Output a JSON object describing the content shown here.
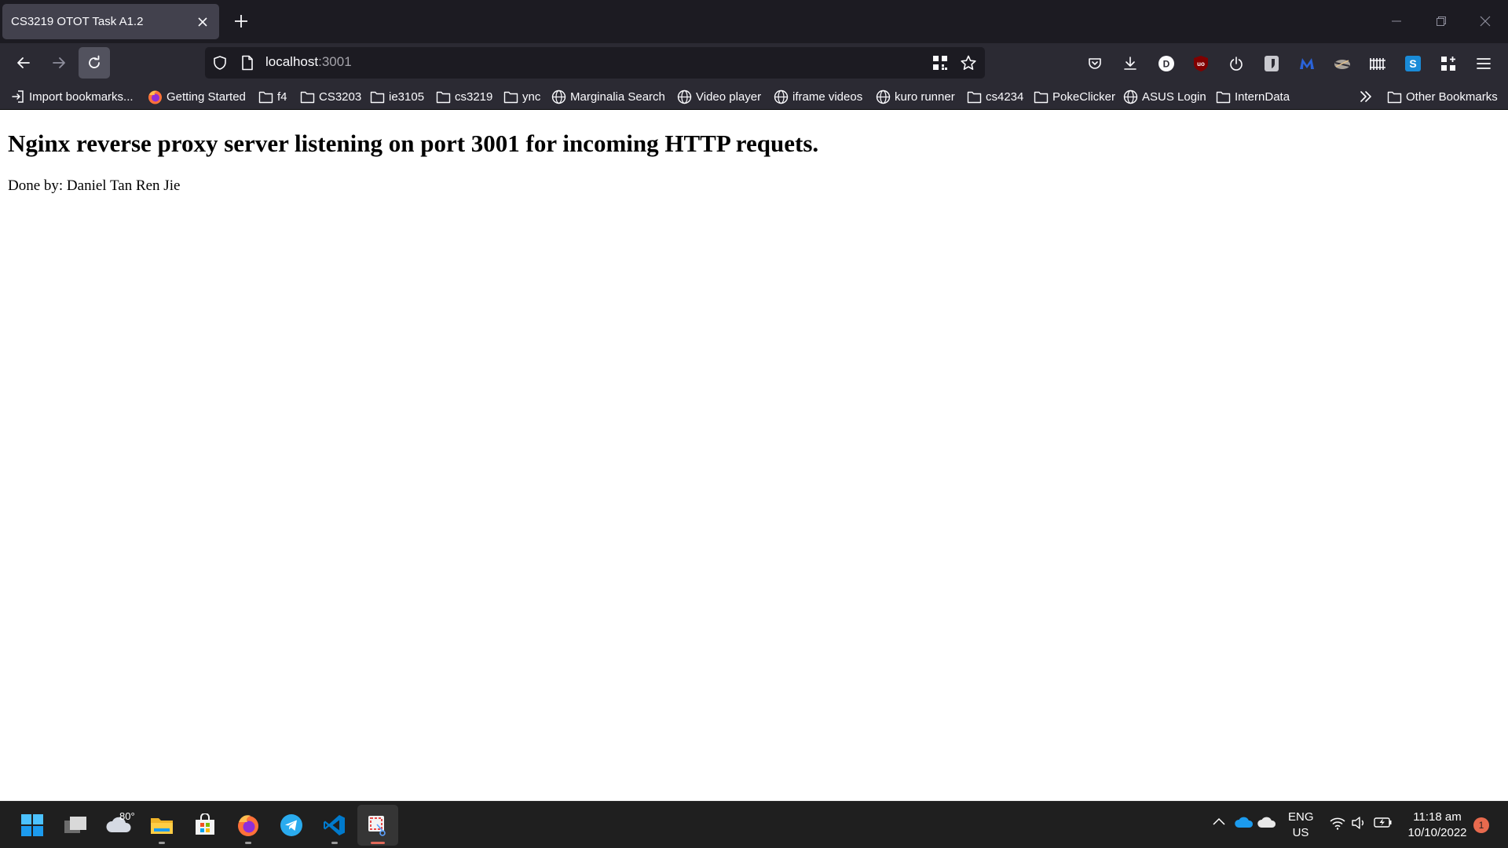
{
  "browser": {
    "tab": {
      "title": "CS3219 OTOT Task A1.2"
    },
    "url": {
      "host": "localhost",
      "port": ":3001"
    }
  },
  "bookmarks": [
    {
      "label": "Import bookmarks...",
      "icon": "import-icon"
    },
    {
      "label": "Getting Started",
      "icon": "firefox-icon"
    },
    {
      "label": "f4",
      "icon": "folder-icon"
    },
    {
      "label": "CS3203",
      "icon": "folder-icon"
    },
    {
      "label": "ie3105",
      "icon": "folder-icon"
    },
    {
      "label": "cs3219",
      "icon": "folder-icon"
    },
    {
      "label": "ync",
      "icon": "folder-icon"
    },
    {
      "label": "Marginalia Search",
      "icon": "globe-icon"
    },
    {
      "label": "Video player",
      "icon": "globe-icon"
    },
    {
      "label": "iframe videos",
      "icon": "globe-icon"
    },
    {
      "label": "kuro runner",
      "icon": "globe-icon"
    },
    {
      "label": "cs4234",
      "icon": "folder-icon"
    },
    {
      "label": "PokeClicker",
      "icon": "folder-icon"
    },
    {
      "label": "ASUS Login",
      "icon": "globe-icon"
    },
    {
      "label": "InternData",
      "icon": "folder-icon"
    }
  ],
  "other_bookmarks": "Other Bookmarks",
  "page": {
    "heading": "Nginx reverse proxy server listening on port 3001 for incoming HTTP requets.",
    "paragraph": "Done by: Daniel Tan Ren Jie"
  },
  "taskbar": {
    "weather_temp": "80°",
    "language": "ENG",
    "region": "US",
    "time": "11:18 am",
    "date": "10/10/2022",
    "notification_count": "1"
  },
  "colors": {
    "tabstrip": "#1c1b22",
    "toolbar": "#2b2a33",
    "active_tab": "#42414d",
    "taskbar": "#1f1f1f",
    "notification": "#e86a4e"
  }
}
